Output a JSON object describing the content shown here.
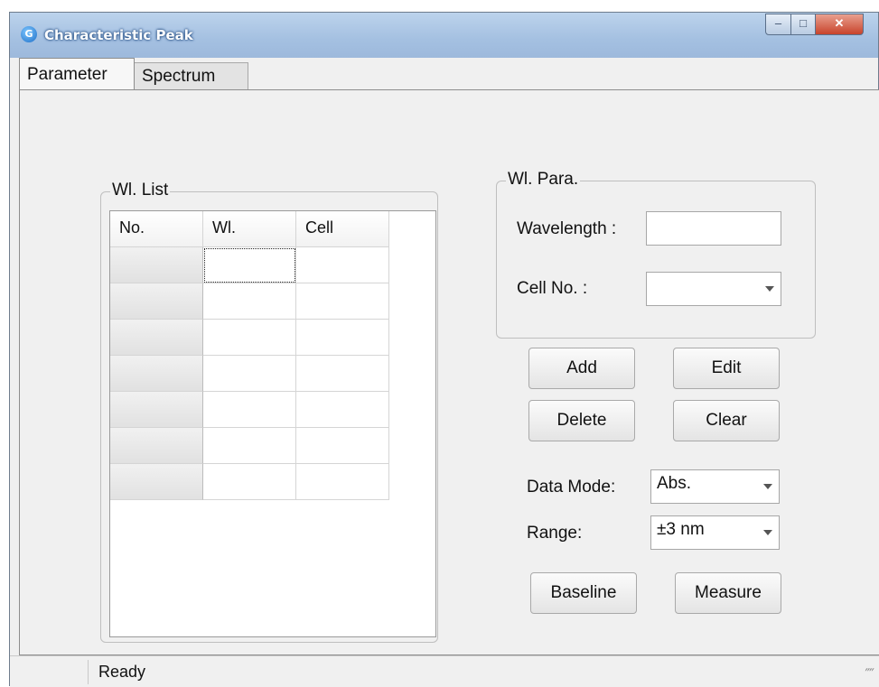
{
  "window": {
    "title": "Characteristic Peak",
    "app_icon_letter": "G"
  },
  "tabs": [
    {
      "label": "Parameter"
    },
    {
      "label": "Spectrum"
    }
  ],
  "wl_list": {
    "title": "Wl. List",
    "columns": [
      "No.",
      "Wl.",
      "Cell"
    ],
    "rows": [
      [
        "",
        "",
        ""
      ],
      [
        "",
        "",
        ""
      ],
      [
        "",
        "",
        ""
      ],
      [
        "",
        "",
        ""
      ],
      [
        "",
        "",
        ""
      ],
      [
        "",
        "",
        ""
      ],
      [
        "",
        "",
        ""
      ]
    ]
  },
  "wl_para": {
    "title": "Wl. Para.",
    "wavelength_label": "Wavelength :",
    "wavelength_value": "",
    "cell_label": "Cell No. :",
    "cell_value": ""
  },
  "buttons": {
    "add": "Add",
    "edit": "Edit",
    "delete": "Delete",
    "clear": "Clear",
    "baseline": "Baseline",
    "measure": "Measure"
  },
  "data_mode": {
    "label": "Data Mode:",
    "value": "Abs."
  },
  "range": {
    "label": "Range:",
    "value": "±3 nm"
  },
  "status": {
    "text": "Ready"
  }
}
